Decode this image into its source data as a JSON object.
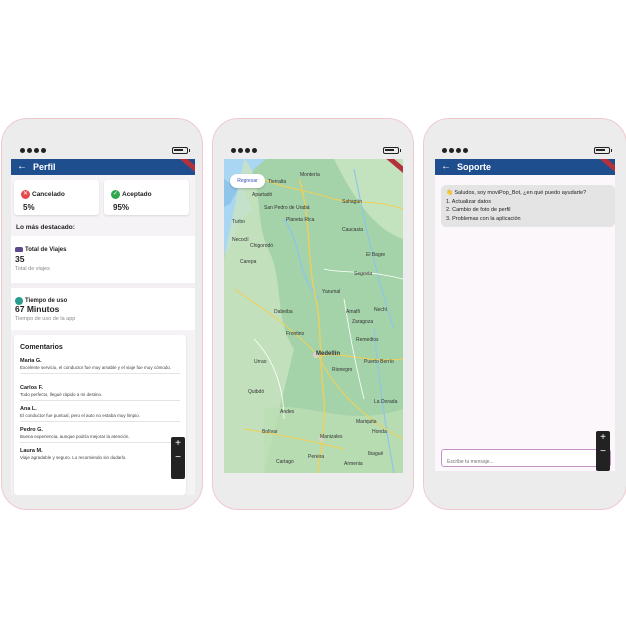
{
  "profile": {
    "title": "Perfil",
    "cancelled": {
      "label": "Cancelado",
      "value": "5%"
    },
    "accepted": {
      "label": "Aceptado",
      "value": "95%"
    },
    "highlights_title": "Lo más destacado:",
    "trips": {
      "label": "Total de Viajes",
      "value": "35",
      "sub": "Total de viajes"
    },
    "usage": {
      "label": "Tiempo de uso",
      "value": "67 Minutos",
      "sub": "Tiempo de uso de la app"
    },
    "comments_title": "Comentarios",
    "comments": [
      {
        "name": "Maria G.",
        "text": "Excelente servicio, el conductor fue muy amable y el viaje fue muy cómodo."
      },
      {
        "name": "Carlos F.",
        "text": "Todo perfecto, llegué rápido a mi destino."
      },
      {
        "name": "Ana L.",
        "text": "El conductor fue puntual, pero el auto no estaba muy limpio."
      },
      {
        "name": "Pedro G.",
        "text": "Buena experiencia, aunque podría mejorar la atención."
      },
      {
        "name": "Laura M.",
        "text": "Viaje agradable y seguro. Lo recomiendo sin dudarlo."
      }
    ],
    "zoom_in": "+",
    "zoom_out": "−"
  },
  "map": {
    "back_button": "Regresar",
    "places": [
      "Montería",
      "San Pedro de Urabá",
      "Caucasia",
      "Apartadó",
      "Yarumal",
      "Medellín",
      "Rionegro",
      "Manizales",
      "Pereira",
      "Quibdó",
      "Puerto Berrío",
      "Segovia",
      "El Bagre",
      "Turbo",
      "Planeta Rica",
      "Sahagún",
      "Chigorodó",
      "Dabeiba",
      "Frontino",
      "Andes",
      "Carepa",
      "Nechí",
      "Zaragoza",
      "Cartago",
      "Armenia",
      "Ibagué",
      "La Dorada",
      "Bolívar",
      "Remedios",
      "Tierralta",
      "Urrao",
      "Amalfi",
      "Mariquita",
      "Necoclí",
      "Honda"
    ]
  },
  "support": {
    "title": "Soporte",
    "bubble_lines": [
      "👋 Saludos, soy moviPop_Bot, ¿en qué puedo ayudarte?",
      "1. Actualizar datos",
      "2. Cambio de foto de perfil",
      "3. Problemas con la aplicación"
    ],
    "input_placeholder": "Escribe tu mensaje...",
    "zoom_in": "+",
    "zoom_out": "−"
  },
  "colors": {
    "appbar": "#1f4e8f",
    "cancel": "#e5484d",
    "accept": "#2fa84f",
    "map_land": "#a5d3a9",
    "input_border": "#c593c8"
  },
  "icons": [
    "arrow-left-icon",
    "cancel-icon",
    "check-icon",
    "car-icon",
    "clock-icon",
    "plus-icon",
    "minus-icon",
    "wave-icon"
  ]
}
